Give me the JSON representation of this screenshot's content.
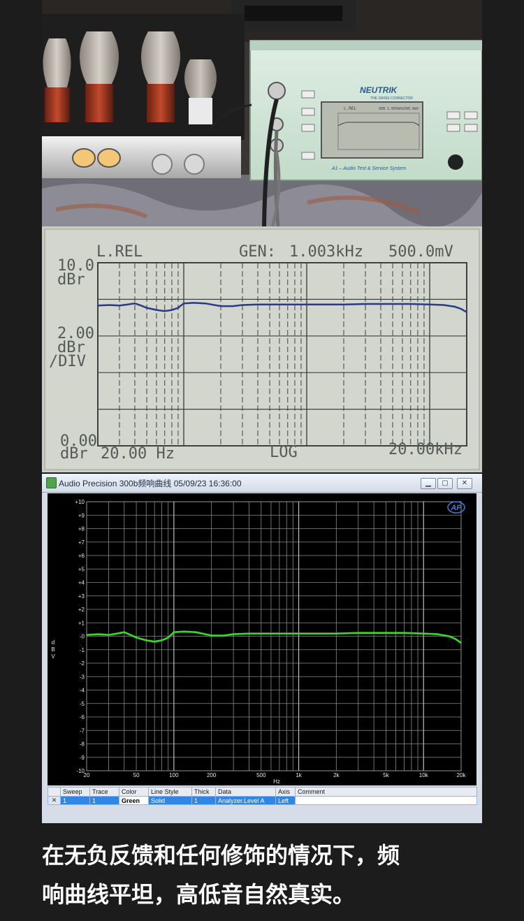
{
  "photo": {
    "device_brand": "NEUTRIK",
    "device_tagline": "THE SWISS CONNECTOR",
    "device_name": "A1 – Audio Test & Service System",
    "screen_title": "L.REL",
    "screen_gen": "GEN 1.003kHz",
    "screen_level": "500.0mV",
    "icon": "tube-amplifier-photo"
  },
  "lcd": {
    "title": "L.REL",
    "gen_label": "GEN:",
    "gen_freq": "1.003kHz",
    "gen_level": "500.0mV",
    "y_top_value": "10.0",
    "y_top_unit": "dBr",
    "scale_value": "2.00",
    "scale_unit1": "dBr",
    "scale_unit2": "/DIV",
    "y_bottom_value": "0.00",
    "y_bottom_unit": "dBr",
    "x_start": "20.00 Hz",
    "x_mode": "LOG",
    "x_end": "20.00kHz",
    "trace_color": "#2a3a8a"
  },
  "window": {
    "title": "Audio Precision  300b频响曲线  05/09/23 16:36:00",
    "logo": "AP",
    "controls": {
      "minimize": "▁",
      "maximize": "▢",
      "close": "✕"
    }
  },
  "chart_data": {
    "type": "line",
    "ylabel": "d B V",
    "xlabel": "Hz",
    "xscale": "log",
    "xlim": [
      20,
      20000
    ],
    "ylim": [
      -10,
      10
    ],
    "y_ticks": [
      "+10",
      "+9",
      "+8",
      "+7",
      "+6",
      "+5",
      "+4",
      "+3",
      "+2",
      "+1",
      "-0",
      "-1",
      "-2",
      "-3",
      "-4",
      "-5",
      "-6",
      "-7",
      "-8",
      "-9",
      "-10"
    ],
    "x_ticks": [
      {
        "v": 20,
        "label": "20"
      },
      {
        "v": 50,
        "label": "50"
      },
      {
        "v": 100,
        "label": "100"
      },
      {
        "v": 200,
        "label": "200"
      },
      {
        "v": 500,
        "label": "500"
      },
      {
        "v": 1000,
        "label": "1k"
      },
      {
        "v": 2000,
        "label": "2k"
      },
      {
        "v": 5000,
        "label": "5k"
      },
      {
        "v": 10000,
        "label": "10k"
      },
      {
        "v": 20000,
        "label": "20k"
      }
    ],
    "grid": true,
    "series": [
      {
        "color": "#33dd22",
        "x": [
          20,
          25,
          30,
          35,
          40,
          45,
          50,
          60,
          70,
          80,
          90,
          100,
          120,
          150,
          200,
          250,
          300,
          400,
          500,
          700,
          1000,
          1500,
          2000,
          3000,
          5000,
          7000,
          10000,
          13000,
          16000,
          18000,
          20000
        ],
        "y": [
          0.1,
          0.15,
          0.1,
          0.2,
          0.3,
          0.1,
          -0.1,
          -0.3,
          -0.4,
          -0.3,
          -0.1,
          0.3,
          0.35,
          0.3,
          0.05,
          0.05,
          0.15,
          0.2,
          0.2,
          0.2,
          0.2,
          0.2,
          0.2,
          0.25,
          0.25,
          0.25,
          0.2,
          0.15,
          0.0,
          -0.2,
          -0.5
        ]
      }
    ]
  },
  "table": {
    "headers": [
      "",
      "Sweep",
      "Trace",
      "Color",
      "Line Style",
      "Thick",
      "Data",
      "Axis",
      "Comment"
    ],
    "row": {
      "check": "✕",
      "sweep": "1",
      "trace": "1",
      "color": "Green",
      "line_style": "Solid",
      "thick": "1",
      "data": "Analyzer.Level A",
      "axis": "Left",
      "comment": ""
    }
  },
  "caption": {
    "line1": "在无负反馈和任何修饰的情况下，频",
    "line2": "响曲线平坦，高低音自然真实。"
  }
}
